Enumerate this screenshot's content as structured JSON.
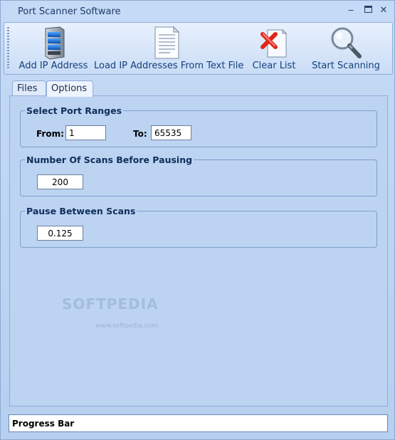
{
  "window": {
    "title": "Port Scanner Software"
  },
  "toolbar": {
    "items": [
      {
        "label": "Add IP Address",
        "icon": "server-icon"
      },
      {
        "label": "Load IP Addresses From Text File",
        "icon": "document-icon"
      },
      {
        "label": "Clear List",
        "icon": "clear-x-icon"
      },
      {
        "label": "Start Scanning",
        "icon": "magnifier-icon"
      }
    ]
  },
  "tabs": [
    {
      "label": "Files",
      "active": false
    },
    {
      "label": "Options",
      "active": true
    }
  ],
  "options": {
    "port_ranges": {
      "legend": "Select Port Ranges",
      "from_label": "From:",
      "from_value": "1",
      "to_label": "To:",
      "to_value": "65535"
    },
    "scans_before_pause": {
      "legend": "Number Of Scans Before Pausing",
      "value": "200"
    },
    "pause_between": {
      "legend": "Pause Between Scans",
      "value": "0.125"
    }
  },
  "progress": {
    "label": "Progress Bar"
  },
  "watermark": {
    "text": "SOFTPEDIA",
    "sub": "www.softpedia.com"
  }
}
